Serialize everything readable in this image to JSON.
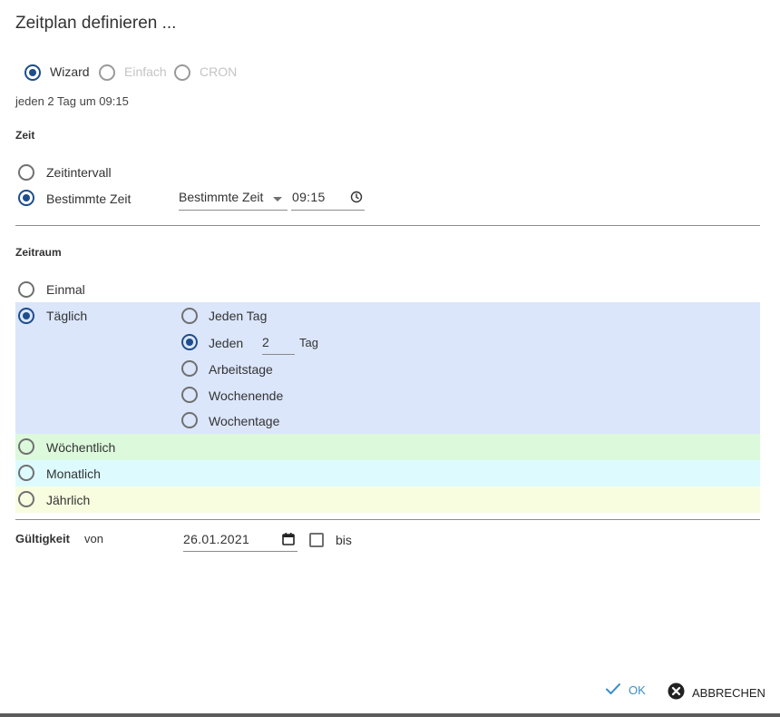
{
  "dialog": {
    "title": "Zeitplan definieren ...",
    "summary": "jeden 2 Tag um 09:15"
  },
  "mode": {
    "options": [
      {
        "label": "Wizard",
        "checked": true,
        "enabled": true
      },
      {
        "label": "Einfach",
        "checked": false,
        "enabled": false
      },
      {
        "label": "CRON",
        "checked": false,
        "enabled": false
      }
    ]
  },
  "zeit": {
    "heading": "Zeit",
    "options": [
      {
        "label": "Zeitintervall",
        "checked": false
      },
      {
        "label": "Bestimmte Zeit",
        "checked": true
      }
    ],
    "select_value": "Bestimmte Zeit",
    "time_value": "09:15",
    "icons": {
      "caret": "chevron-down-icon",
      "clock": "clock-icon"
    }
  },
  "zeitraum": {
    "heading": "Zeitraum",
    "options": [
      {
        "label": "Einmal",
        "checked": false
      },
      {
        "label": "Täglich",
        "checked": true
      },
      {
        "label": "Wöchentlich",
        "checked": false
      },
      {
        "label": "Monatlich",
        "checked": false
      },
      {
        "label": "Jährlich",
        "checked": false
      }
    ],
    "daily": {
      "options": [
        {
          "label": "Jeden Tag",
          "checked": false
        },
        {
          "label": "Jeden",
          "checked": true
        },
        {
          "label": "Arbeitstage",
          "checked": false
        },
        {
          "label": "Wochenende",
          "checked": false
        },
        {
          "label": "Wochentage",
          "checked": false
        }
      ],
      "interval_value": "2",
      "interval_unit": "Tag"
    },
    "band_colors": {
      "daily": "#dbe6fb",
      "weekly": "#dcf9dc",
      "monthly": "#ddfbfe",
      "yearly": "#f9fde0"
    }
  },
  "gueltigkeit": {
    "heading": "Gültigkeit",
    "from_label": "von",
    "from_date": "26.01.2021",
    "to_label": "bis",
    "to_checked": false,
    "icons": {
      "calendar": "calendar-icon"
    }
  },
  "actions": {
    "ok_label": "OK",
    "cancel_label": "ABBRECHEN",
    "ok_color": "#3b8fc9",
    "icons": {
      "ok": "check-icon",
      "cancel": "close-circle-icon"
    }
  }
}
